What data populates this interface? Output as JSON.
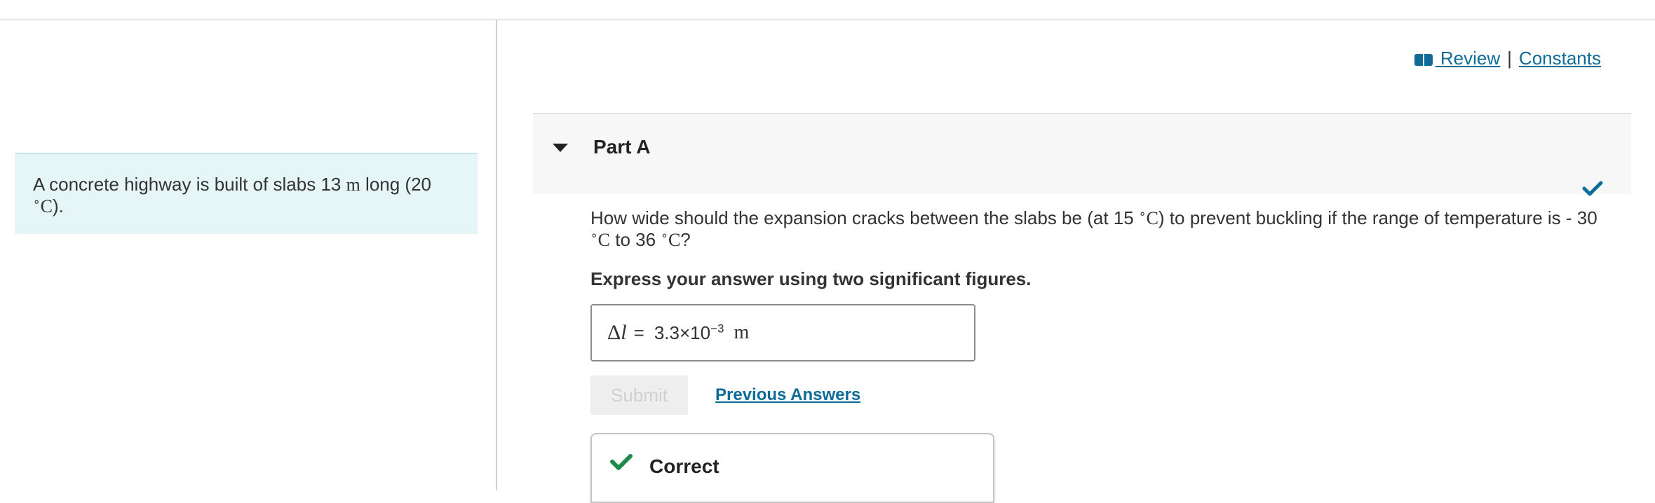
{
  "header": {
    "review_label": " Review",
    "separator": "|",
    "constants_label": "Constants"
  },
  "problem": {
    "intro_prefix": "A concrete highway is built of slabs 13 ",
    "intro_unit_m": "m",
    "intro_mid": " long (20",
    "intro_degree": "∘",
    "intro_unit_c": "C",
    "intro_suffix": ")."
  },
  "part": {
    "title": "Part A",
    "question": {
      "p1": "How wide should the expansion cracks between the slabs be (at 15 ",
      "deg": "∘",
      "c": "C",
      "p2": ") to prevent buckling if the range of temperature is - 30 ",
      "p3": " to 36 ",
      "p4": "?"
    },
    "instruction": "Express your answer using two significant figures.",
    "answer": {
      "symbol_delta": "Δ",
      "symbol_l": "l",
      "equals": "=",
      "mantissa": "3.3×10",
      "exponent": "−3",
      "unit": "m"
    },
    "submit_label": "Submit",
    "previous_answers_label": "Previous Answers",
    "feedback_label": "Correct",
    "status": "correct"
  },
  "colors": {
    "link": "#0e6c96",
    "success": "#1f8a4c",
    "intro_bg": "#e6f5f5"
  },
  "icons": {
    "review": "book-icon",
    "collapse": "caret-down-icon",
    "part_status": "checkmark-icon",
    "feedback": "checkmark-icon"
  }
}
